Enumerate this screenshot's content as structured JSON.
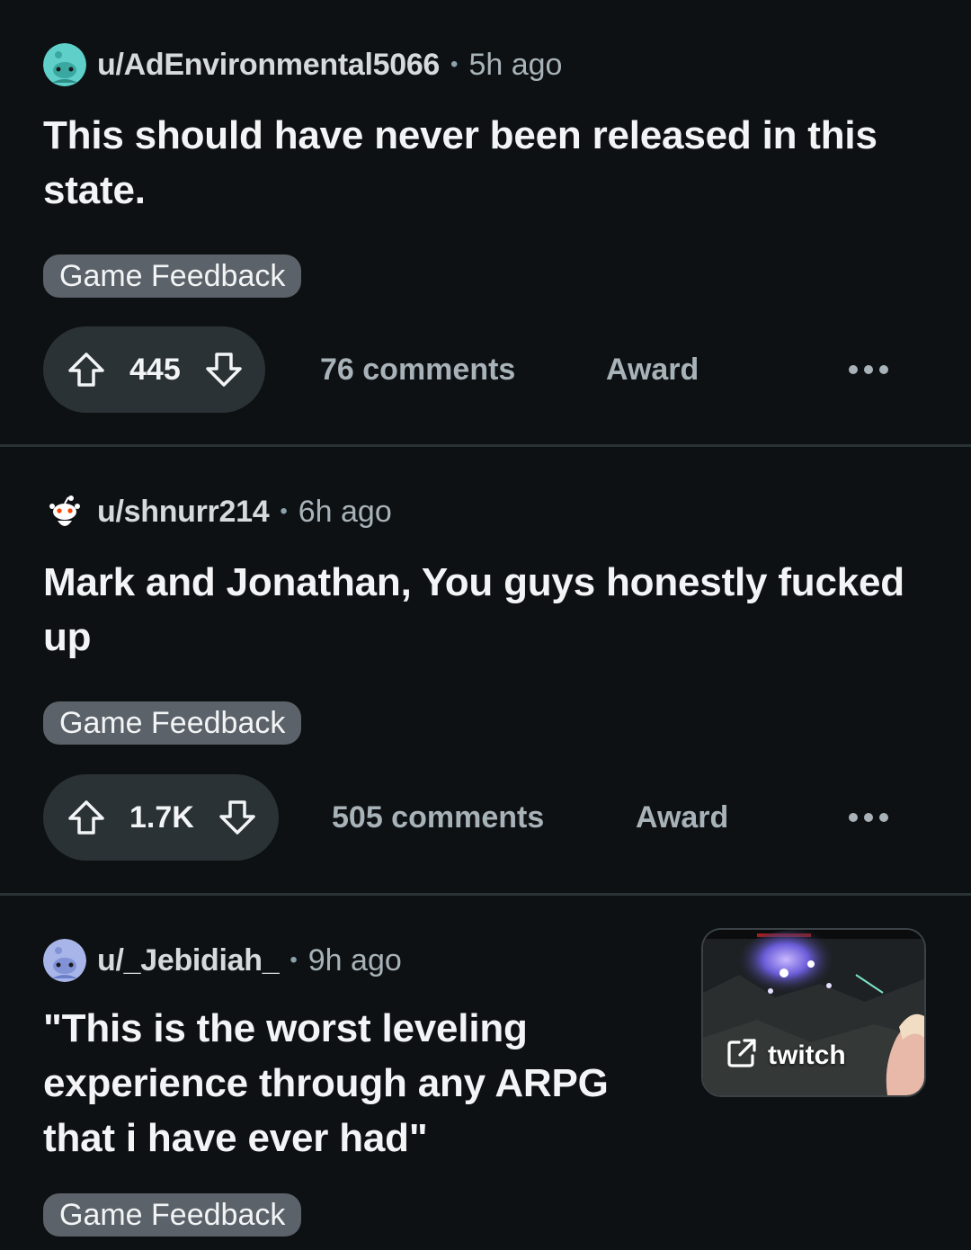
{
  "posts": [
    {
      "author": "u/AdEnvironmental5066",
      "separator": "•",
      "age": "5h ago",
      "title": "This should have never been released in this state.",
      "flair": "Game Feedback",
      "votes": "445",
      "comments": "76 comments",
      "award": "Award",
      "avatar_color": "#5ed0c9"
    },
    {
      "author": "u/shnurr214",
      "separator": "•",
      "age": "6h ago",
      "title": "Mark and Jonathan, You guys honestly fucked up",
      "flair": "Game Feedback",
      "votes": "1.7K",
      "comments": "505 comments",
      "award": "Award",
      "avatar_color": "#0e1113"
    },
    {
      "author": "u/_Jebidiah_",
      "separator": "•",
      "age": "9h ago",
      "title": "\"This is the worst leveling experience through any ARPG that i have ever had\"",
      "flair": "Game Feedback",
      "thumbnail_label": "twitch",
      "avatar_color": "#a8b5e8"
    }
  ],
  "icons": {
    "upvote": "upvote-icon",
    "downvote": "downvote-icon",
    "more": "more-icon",
    "external": "external-link-icon",
    "avatar": "snoo-avatar-icon"
  },
  "colors": {
    "background": "#0e1113",
    "pill": "#2a3236",
    "flair": "#5b6269",
    "muted_text": "#a8b3b9"
  }
}
